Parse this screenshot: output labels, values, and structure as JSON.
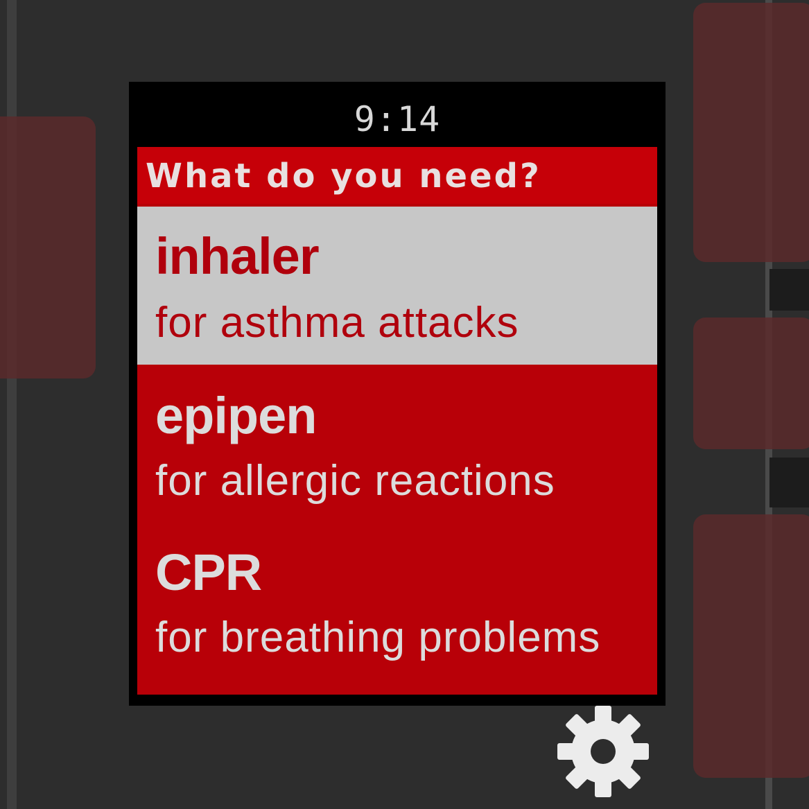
{
  "status_bar": {
    "time": "9:14"
  },
  "menu": {
    "title": "What do you need?",
    "items": [
      {
        "name": "inhaler",
        "description": "for asthma attacks",
        "selected": true
      },
      {
        "name": "epipen",
        "description": "for allergic reactions",
        "selected": false
      },
      {
        "name": "CPR",
        "description": "for breathing problems",
        "selected": false
      }
    ]
  },
  "icons": {
    "settings": "gear-icon"
  },
  "colors": {
    "accent_red": "#b80008",
    "selected_bg": "#c7c7c7",
    "background": "#2d2d2d"
  }
}
